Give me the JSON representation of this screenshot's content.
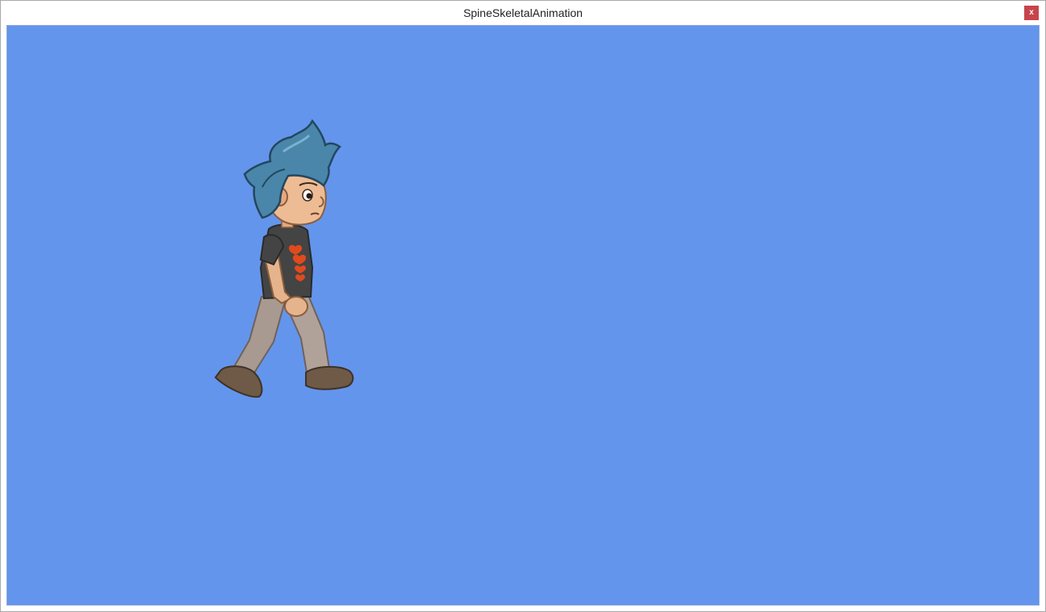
{
  "window": {
    "title": "SpineSkeletalAnimation",
    "close_label": "x",
    "close_color": "#c7454a"
  },
  "scene": {
    "background_color": "#6495ed",
    "sprite": "spineboy-walk"
  }
}
